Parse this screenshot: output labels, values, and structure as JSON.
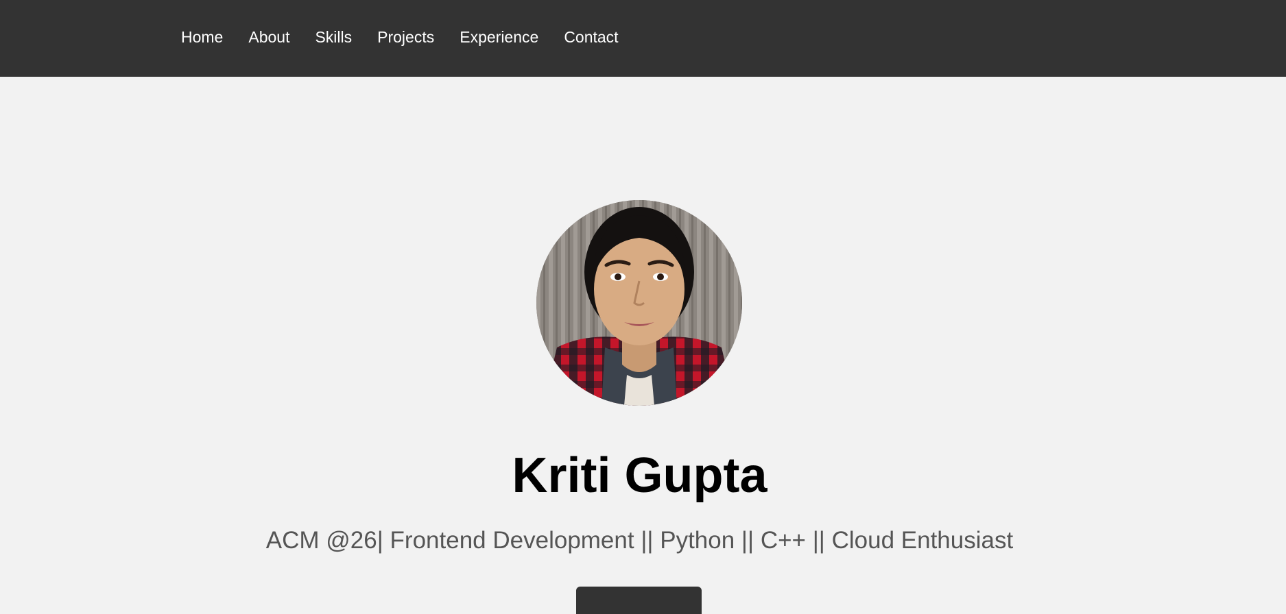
{
  "nav": {
    "items": [
      {
        "label": "Home"
      },
      {
        "label": "About"
      },
      {
        "label": "Skills"
      },
      {
        "label": "Projects"
      },
      {
        "label": "Experience"
      },
      {
        "label": "Contact"
      }
    ]
  },
  "hero": {
    "name": "Kriti Gupta",
    "tagline": "ACM @26| Frontend Development || Python || C++ || Cloud Enthusiast",
    "avatar_icon": "profile-photo"
  },
  "colors": {
    "nav_bg": "#333333",
    "page_bg": "#f2f2f2",
    "tagline": "#555555"
  }
}
